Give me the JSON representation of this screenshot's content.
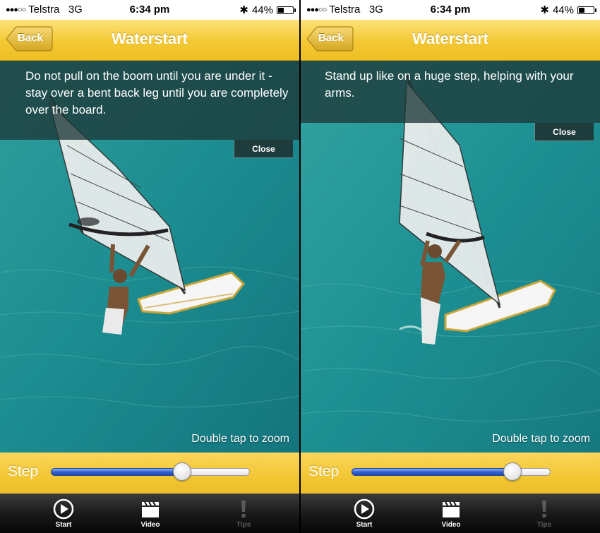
{
  "status": {
    "carrier": "Telstra",
    "network": "3G",
    "signal_dots": "●●●○○",
    "time": "6:34 pm",
    "battery_percent": "44%",
    "battery_level": 0.44,
    "bluetooth_icon": "bluetooth-icon"
  },
  "nav": {
    "back_label": "Back",
    "title": "Waterstart"
  },
  "screens": [
    {
      "tip": "Do not pull on the boom until you are under it - stay over a bent back leg until you are completely over the board.",
      "close_label": "Close",
      "zoom_hint": "Double tap to zoom",
      "step_label": "Step",
      "step_value": 0.66
    },
    {
      "tip": "Stand up like on a huge step, helping with your arms.",
      "close_label": "Close",
      "zoom_hint": "Double tap to zoom",
      "step_label": "Step",
      "step_value": 0.81
    }
  ],
  "tabs": {
    "start": {
      "label": "Start",
      "icon": "play-icon",
      "active": true
    },
    "video": {
      "label": "Video",
      "icon": "clapperboard-icon",
      "active": true
    },
    "tips": {
      "label": "Tips",
      "icon": "exclamation-icon",
      "active": false
    }
  },
  "colors": {
    "navbar_yellow": "#f3c833",
    "water": "#1f8f93",
    "slider_blue": "#2e5fc9"
  }
}
